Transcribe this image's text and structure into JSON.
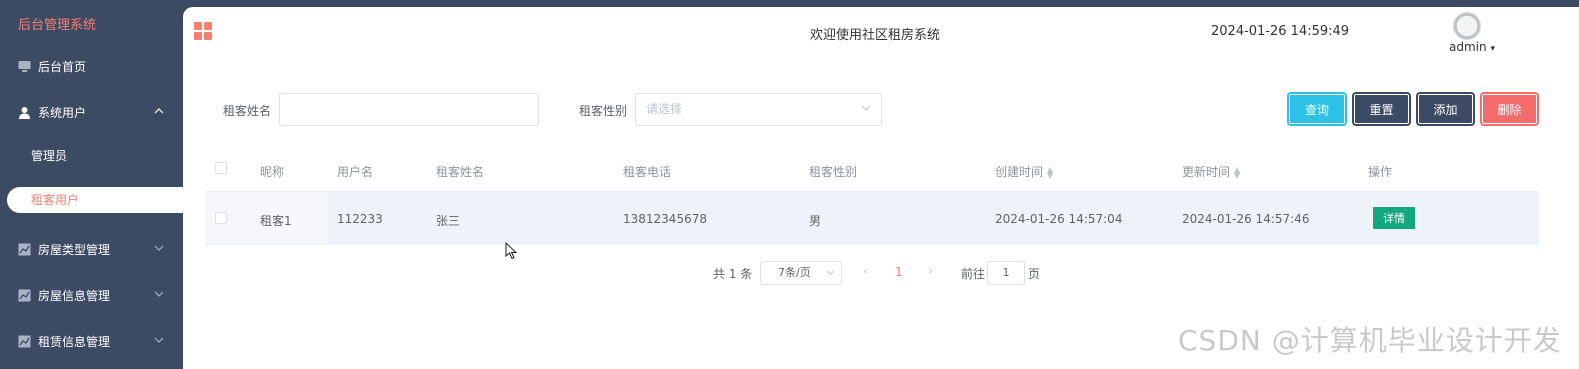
{
  "sidebar": {
    "brand": "后台管理系统",
    "items": [
      {
        "label": "后台首页",
        "icon": "monitor-icon"
      },
      {
        "label": "系统用户",
        "icon": "user-icon",
        "expanded": true,
        "children": [
          {
            "label": "管理员"
          },
          {
            "label": "租客用户",
            "active": true
          }
        ]
      },
      {
        "label": "房屋类型管理",
        "icon": "chart-icon"
      },
      {
        "label": "房屋信息管理",
        "icon": "chart-icon"
      },
      {
        "label": "租赁信息管理",
        "icon": "chart-icon"
      }
    ]
  },
  "header": {
    "title": "欢迎使用社区租房系统",
    "datetime": "2024-01-26 14:59:49",
    "user": "admin"
  },
  "search": {
    "name_label": "租客姓名",
    "name_value": "",
    "gender_label": "租客性别",
    "gender_placeholder": "请选择"
  },
  "buttons": {
    "query": "查询",
    "reset": "重置",
    "add": "添加",
    "delete": "删除"
  },
  "table": {
    "columns": [
      "昵称",
      "用户名",
      "租客姓名",
      "租客电话",
      "租客性别",
      "创建时间",
      "更新时间",
      "操作"
    ],
    "rows": [
      {
        "nickname": "租客1",
        "username": "112233",
        "name": "张三",
        "phone": "13812345678",
        "gender": "男",
        "created": "2024-01-26 14:57:04",
        "updated": "2024-01-26 14:57:46",
        "action": "详情"
      }
    ]
  },
  "pagination": {
    "total": "共 1 条",
    "page_size": "7条/页",
    "current": "1",
    "goto_label": "前往",
    "goto_value": "1",
    "page_unit": "页"
  },
  "watermark": "CSDN @计算机毕业设计开发",
  "colors": {
    "accent": "#f4806f",
    "sidebar": "#3d4a63",
    "query": "#2ec1e8",
    "delete": "#f56c6c",
    "detail": "#13a77f"
  }
}
